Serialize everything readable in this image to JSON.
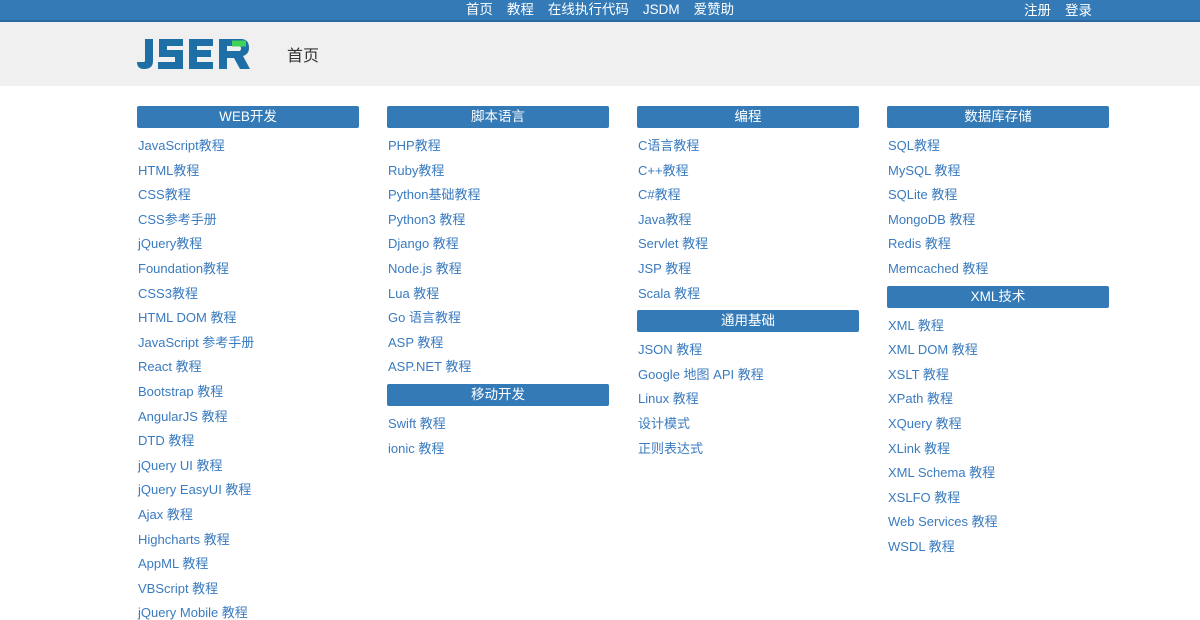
{
  "topnav": {
    "main_links": [
      {
        "label": "首页",
        "name": "nav-home"
      },
      {
        "label": "教程",
        "name": "nav-tutorials"
      },
      {
        "label": "在线执行代码",
        "name": "nav-run-code"
      },
      {
        "label": "JSDM",
        "name": "nav-jsdm"
      },
      {
        "label": "爱赞助",
        "name": "nav-sponsor"
      }
    ],
    "right_links": [
      {
        "label": "注册",
        "name": "nav-register"
      },
      {
        "label": "登录",
        "name": "nav-login"
      }
    ],
    "background_color": "#337ab7",
    "text_color": "#ffffff"
  },
  "subheader": {
    "logo_text": "JSER",
    "logo_color": "#1d6fa5",
    "logo_accent_color": "#3fd35a",
    "title": "首页",
    "background_color": "#f0f0f0"
  },
  "theme": {
    "accent": "#337ab7",
    "link_color": "#3a7bbf",
    "page_background": "#ffffff"
  },
  "columns": [
    {
      "name": "column-web",
      "sections": [
        {
          "title": "WEB开发",
          "name": "section-web-development",
          "items": [
            "JavaScript教程",
            "HTML教程",
            "CSS教程",
            "CSS参考手册",
            "jQuery教程",
            "Foundation教程",
            "CSS3教程",
            "HTML DOM 教程",
            "JavaScript 参考手册",
            "React 教程",
            "Bootstrap 教程",
            "AngularJS 教程",
            "DTD 教程",
            "jQuery UI 教程",
            "jQuery EasyUI 教程",
            "Ajax 教程",
            "Highcharts 教程",
            "AppML 教程",
            "VBScript 教程",
            "jQuery Mobile 教程"
          ]
        }
      ]
    },
    {
      "name": "column-scripting",
      "sections": [
        {
          "title": "脚本语言",
          "name": "section-scripting-languages",
          "items": [
            "PHP教程",
            "Ruby教程",
            "Python基础教程",
            "Python3 教程",
            "Django 教程",
            "Node.js 教程",
            "Lua 教程",
            "Go 语言教程",
            "ASP 教程",
            "ASP.NET 教程"
          ]
        },
        {
          "title": "移动开发",
          "name": "section-mobile-development",
          "items": [
            "Swift 教程",
            "ionic 教程"
          ]
        }
      ]
    },
    {
      "name": "column-programming",
      "sections": [
        {
          "title": "编程",
          "name": "section-programming",
          "items": [
            "C语言教程",
            "C++教程",
            "C#教程",
            "Java教程",
            "Servlet 教程",
            "JSP 教程",
            "Scala 教程"
          ]
        },
        {
          "title": "通用基础",
          "name": "section-general-basics",
          "items": [
            "JSON 教程",
            "Google 地图 API 教程",
            "Linux 教程",
            "设计模式",
            "正则表达式"
          ]
        }
      ]
    },
    {
      "name": "column-database",
      "sections": [
        {
          "title": "数据库存储",
          "name": "section-database-storage",
          "items": [
            "SQL教程",
            "MySQL 教程",
            "SQLite 教程",
            "MongoDB 教程",
            "Redis 教程",
            "Memcached 教程"
          ]
        },
        {
          "title": "XML技术",
          "name": "section-xml-technology",
          "items": [
            "XML 教程",
            "XML DOM 教程",
            "XSLT 教程",
            "XPath 教程",
            "XQuery 教程",
            "XLink 教程",
            "XML Schema 教程",
            "XSLFO 教程",
            "Web Services 教程",
            "WSDL 教程"
          ]
        }
      ]
    }
  ]
}
